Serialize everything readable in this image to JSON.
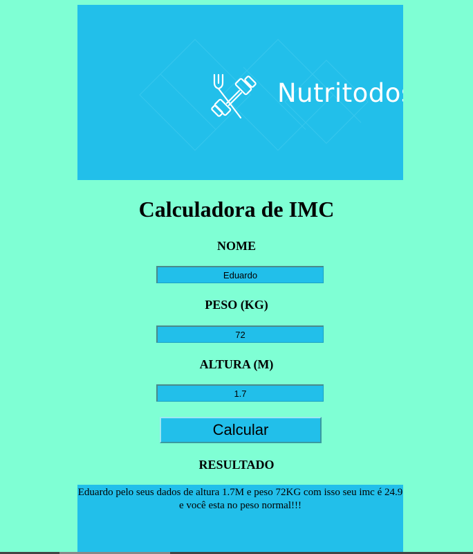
{
  "banner": {
    "brand": "Nutritodos",
    "logo_icon": "fork-dumbbell-icon",
    "background_color": "#22bfea"
  },
  "page": {
    "title": "Calculadora de IMC",
    "background_color": "#7fffd4"
  },
  "form": {
    "name_label": "NOME",
    "name_value": "Eduardo",
    "weight_label": "PESO (KG)",
    "weight_value": "72",
    "height_label": "ALTURA (M)",
    "height_value": "1.7",
    "calculate_label": "Calcular"
  },
  "result": {
    "heading": "RESULTADO",
    "text": "Eduardo pelo seus dados de altura 1.7M e peso 72KG com isso seu imc é 24.9 e você esta no peso normal!!!"
  }
}
